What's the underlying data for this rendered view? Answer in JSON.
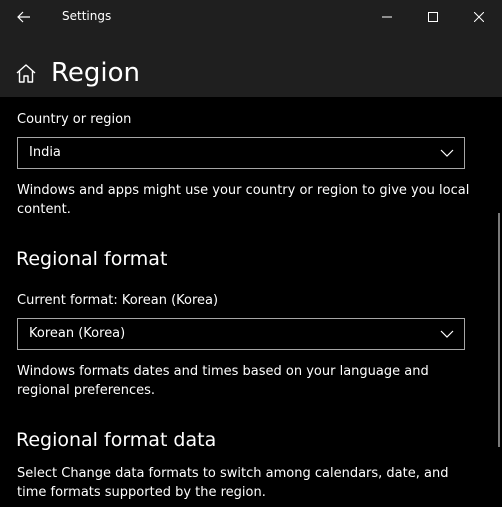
{
  "window": {
    "title": "Settings"
  },
  "header": {
    "page_title": "Region"
  },
  "country": {
    "label": "Country or region",
    "selected": "India",
    "description": "Windows and apps might use your country or region to give you local content."
  },
  "regional_format": {
    "heading": "Regional format",
    "current_label": "Current format: Korean (Korea)",
    "selected": "Korean (Korea)",
    "description": "Windows formats dates and times based on your language and regional preferences."
  },
  "regional_format_data": {
    "heading": "Regional format data",
    "description": "Select Change data formats to switch among calendars, date, and time formats supported by the region."
  },
  "colors": {
    "background": "#000000",
    "titlebar": "#1f1f1f",
    "text": "#ffffff",
    "border": "#a6a6a6"
  }
}
